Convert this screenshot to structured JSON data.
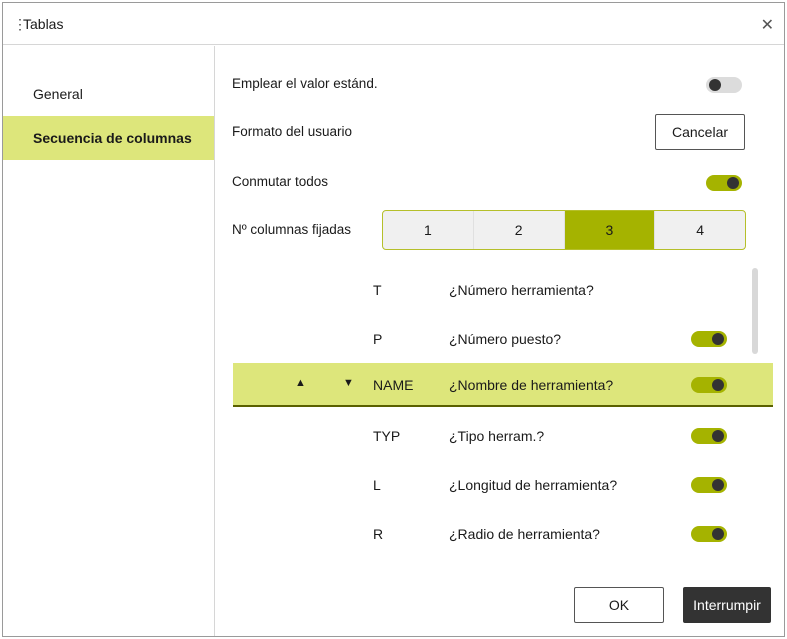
{
  "dialog": {
    "title": "Tablas",
    "close_icon": "close-icon"
  },
  "sidebar": {
    "items": [
      {
        "label": "General",
        "active": false
      },
      {
        "label": "Secuencia de columnas",
        "active": true
      }
    ]
  },
  "settings": {
    "use_default_label": "Emplear el valor estánd.",
    "use_default_on": false,
    "user_format_label": "Formato del usuario",
    "cancel_label": "Cancelar",
    "toggle_all_label": "Conmutar todos",
    "toggle_all_on": true,
    "fixed_columns_label": "Nº columnas fijadas",
    "fixed_options": [
      "1",
      "2",
      "3",
      "4"
    ],
    "fixed_selected": "3"
  },
  "columns": [
    {
      "code": "T",
      "desc": "¿Número herramienta?",
      "enabled": null,
      "selected": false
    },
    {
      "code": "P",
      "desc": "¿Número puesto?",
      "enabled": true,
      "selected": false
    },
    {
      "code": "NAME",
      "desc": "¿Nombre de herramienta?",
      "enabled": true,
      "selected": true
    },
    {
      "code": "TYP",
      "desc": "¿Tipo herram.?",
      "enabled": true,
      "selected": false
    },
    {
      "code": "L",
      "desc": "¿Longitud de herramienta?",
      "enabled": true,
      "selected": false
    },
    {
      "code": "R",
      "desc": "¿Radio de herramienta?",
      "enabled": true,
      "selected": false
    }
  ],
  "footer": {
    "ok_label": "OK",
    "abort_label": "Interrumpir"
  },
  "colors": {
    "accent": "#a5b300",
    "highlight": "#dde67b",
    "dark": "#333333"
  }
}
